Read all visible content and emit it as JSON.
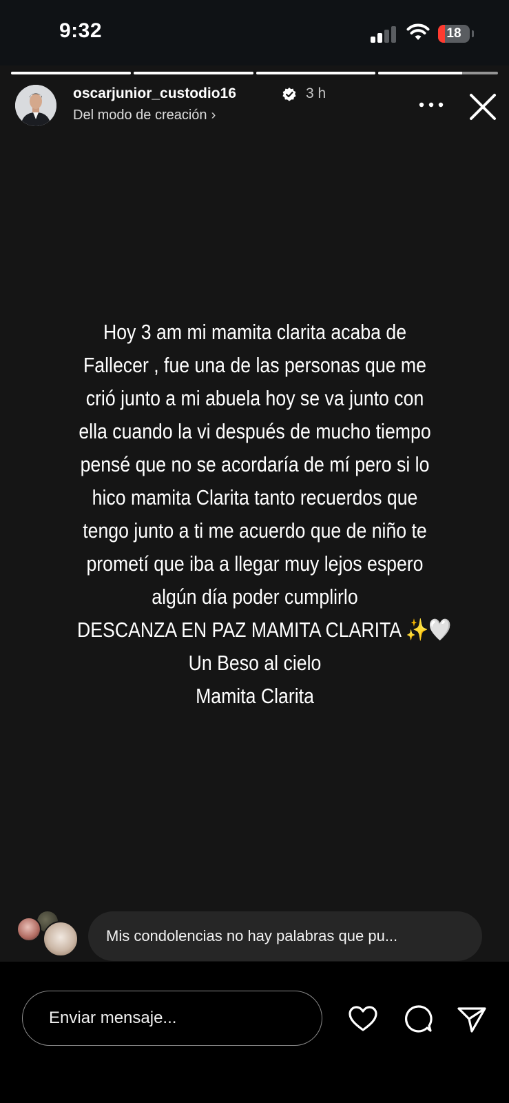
{
  "status_bar": {
    "time": "9:32",
    "battery_level": "18",
    "signal_bars": 2,
    "colors": {
      "battery_low": "#ff3b30"
    }
  },
  "story": {
    "segments_total": 4,
    "current_segment": 4,
    "current_segment_progress": 0.7,
    "author": {
      "username": "oscarjunior_custodio16",
      "verified_icon": "verified-badge-icon",
      "time_ago": "3 h",
      "subtitle": "Del modo de creación",
      "subtitle_icon": "chevron-right-icon"
    },
    "text_lines": [
      "Hoy 3 am mi mamita clarita acaba de",
      "Fallecer ,  fue una de las personas que me",
      "crió junto a mi abuela hoy se va junto con",
      "ella cuando la vi después de mucho tiempo",
      "pensé que no se acordaría de mí pero si lo",
      "hico mamita Clarita tanto recuerdos que",
      "tengo junto a ti me acuerdo que de niño te",
      "prometí que iba a llegar muy lejos espero",
      "algún día poder cumplirlo",
      "DESCANZA EN PAZ MAMITA CLARITA ✨🤍",
      "Un Beso al cielo",
      "Mamita Clarita"
    ],
    "reply_preview": "Mis condolencias no hay palabras que pu..."
  },
  "composer": {
    "placeholder": "Enviar mensaje...",
    "actions": [
      "heart-icon",
      "comment-icon",
      "send-icon"
    ]
  }
}
